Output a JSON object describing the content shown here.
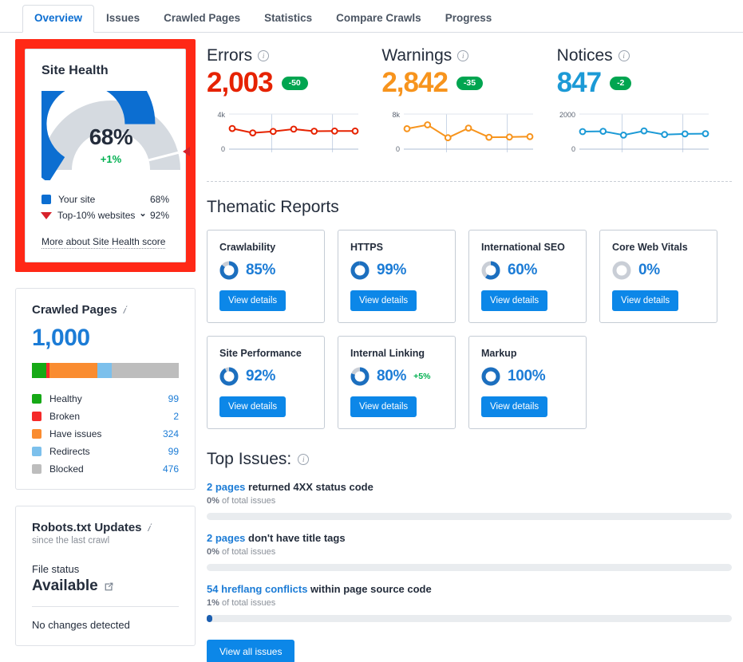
{
  "tabs": [
    {
      "label": "Overview",
      "active": true
    },
    {
      "label": "Issues",
      "active": false
    },
    {
      "label": "Crawled Pages",
      "active": false
    },
    {
      "label": "Statistics",
      "active": false
    },
    {
      "label": "Compare Crawls",
      "active": false
    },
    {
      "label": "Progress",
      "active": false
    }
  ],
  "site_health": {
    "title": "Site Health",
    "score": "68%",
    "delta": "+1%",
    "score_value": 68,
    "benchmark_value": 92,
    "legend": [
      {
        "label": "Your site",
        "value": "68%",
        "color": "#0c6ed1",
        "marker": "square"
      },
      {
        "label": "Top-10% websites",
        "value": "92%",
        "color": "#d7222a",
        "marker": "triangle"
      }
    ],
    "more_link": "More about Site Health score",
    "colors": {
      "fill": "#0c6ed1",
      "track": "#d5dae0",
      "marker": "#d7222a",
      "highlight_border": "#ff2816"
    }
  },
  "crawled_pages": {
    "title": "Crawled Pages",
    "total": "1,000",
    "segments": [
      {
        "label": "Healthy",
        "value": "99",
        "pct": 9.9,
        "color": "#16a916"
      },
      {
        "label": "Broken",
        "value": "2",
        "pct": 2.2,
        "color": "#f52a2a"
      },
      {
        "label": "Have issues",
        "value": "324",
        "pct": 32.4,
        "color": "#fa8c30"
      },
      {
        "label": "Redirects",
        "value": "99",
        "pct": 9.9,
        "color": "#7cc0ec"
      },
      {
        "label": "Blocked",
        "value": "476",
        "pct": 45.6,
        "color": "#bdbdbd"
      }
    ]
  },
  "robots": {
    "title": "Robots.txt Updates",
    "subtitle": "since the last crawl",
    "status_label": "File status",
    "status_value": "Available",
    "note": "No changes detected"
  },
  "metrics": [
    {
      "name": "Errors",
      "value": "2,003",
      "badge": "-50",
      "color": "#e62200",
      "chart": {
        "type": "line",
        "ymax": 4000,
        "ylabels": [
          "4k",
          "0"
        ],
        "values": [
          2350,
          1850,
          2020,
          2280,
          2050,
          2060,
          2060
        ]
      }
    },
    {
      "name": "Warnings",
      "value": "2,842",
      "badge": "-35",
      "color": "#f7941d",
      "chart": {
        "type": "line",
        "ymax": 8000,
        "ylabels": [
          "8k",
          "0"
        ],
        "values": [
          4650,
          5550,
          2600,
          4800,
          2700,
          2760,
          2850
        ]
      }
    },
    {
      "name": "Notices",
      "value": "847",
      "badge": "-2",
      "color": "#1c9ad6",
      "chart": {
        "type": "line",
        "ymax": 2000,
        "ylabels": [
          "2000",
          "0"
        ],
        "values": [
          1000,
          1020,
          800,
          1040,
          830,
          870,
          880
        ]
      }
    }
  ],
  "thematic": {
    "title": "Thematic Reports",
    "button_label": "View details",
    "cards": [
      {
        "title": "Crawlability",
        "pct": "85%",
        "value": 85,
        "delta": ""
      },
      {
        "title": "HTTPS",
        "pct": "99%",
        "value": 99,
        "delta": ""
      },
      {
        "title": "International SEO",
        "pct": "60%",
        "value": 60,
        "delta": ""
      },
      {
        "title": "Core Web Vitals",
        "pct": "0%",
        "value": 0,
        "delta": ""
      },
      {
        "title": "Site Performance",
        "pct": "92%",
        "value": 92,
        "delta": ""
      },
      {
        "title": "Internal Linking",
        "pct": "80%",
        "value": 80,
        "delta": "+5%"
      },
      {
        "title": "Markup",
        "pct": "100%",
        "value": 100,
        "delta": ""
      }
    ]
  },
  "top_issues": {
    "title": "Top Issues:",
    "button_label": "View all issues",
    "items": [
      {
        "link": "2 pages",
        "rest": " returned 4XX status code",
        "pct_label": "0%",
        "pct_suffix": " of total issues",
        "pct": 0
      },
      {
        "link": "2 pages",
        "rest": " don't have title tags",
        "pct_label": "0%",
        "pct_suffix": " of total issues",
        "pct": 0
      },
      {
        "link": "54 hreflang conflicts",
        "rest": " within page source code",
        "pct_label": "1%",
        "pct_suffix": " of total issues",
        "pct": 1
      }
    ]
  },
  "chart_data": [
    {
      "type": "line",
      "title": "Errors",
      "x": [
        1,
        2,
        3,
        4,
        5,
        6,
        7
      ],
      "values": [
        2350,
        1850,
        2020,
        2280,
        2050,
        2060,
        2060
      ],
      "ylim": [
        0,
        4000
      ],
      "ticklabels": [
        "4k",
        "0"
      ],
      "color": "#e62200",
      "grid": true
    },
    {
      "type": "line",
      "title": "Warnings",
      "x": [
        1,
        2,
        3,
        4,
        5,
        6,
        7
      ],
      "values": [
        4650,
        5550,
        2600,
        4800,
        2700,
        2760,
        2850
      ],
      "ylim": [
        0,
        8000
      ],
      "ticklabels": [
        "8k",
        "0"
      ],
      "color": "#f7941d",
      "grid": true
    },
    {
      "type": "line",
      "title": "Notices",
      "x": [
        1,
        2,
        3,
        4,
        5,
        6,
        7
      ],
      "values": [
        1000,
        1020,
        800,
        1040,
        830,
        870,
        880
      ],
      "ylim": [
        0,
        2000
      ],
      "ticklabels": [
        "2000",
        "0"
      ],
      "color": "#1c9ad6",
      "grid": true
    }
  ]
}
